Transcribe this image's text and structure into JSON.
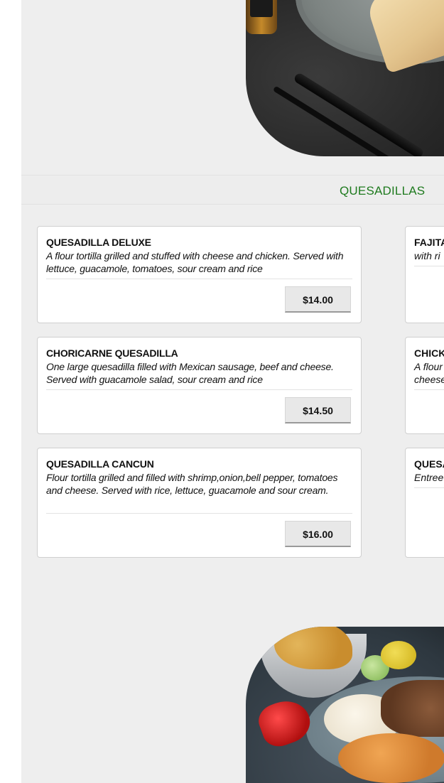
{
  "section": {
    "title": "QUESADILLAS"
  },
  "items": [
    {
      "name": "QUESADILLA DELUXE",
      "description": "A flour tortilla grilled and stuffed with cheese and chicken. Served with lettuce, guacamole, tomatoes, sour cream and rice",
      "price": "$14.00"
    },
    {
      "name": "CHORICARNE QUESADILLA",
      "description": "One large quesadilla filled with Mexican sausage, beef and cheese. Served with guacamole salad, sour cream and rice",
      "price": "$14.50"
    },
    {
      "name": "QUESADILLA CANCUN",
      "description": "Flour tortilla grilled and filled with shrimp,onion,bell pepper, tomatoes and cheese. Served with rice, lettuce, guacamole and sour cream.",
      "price": "$16.00"
    }
  ],
  "right_items": [
    {
      "name": "FAJITA",
      "description": "with ri"
    },
    {
      "name": "CHICK",
      "description": "A flour",
      "description2": "cheese"
    },
    {
      "name": "QUESA",
      "description": "Entree"
    }
  ]
}
